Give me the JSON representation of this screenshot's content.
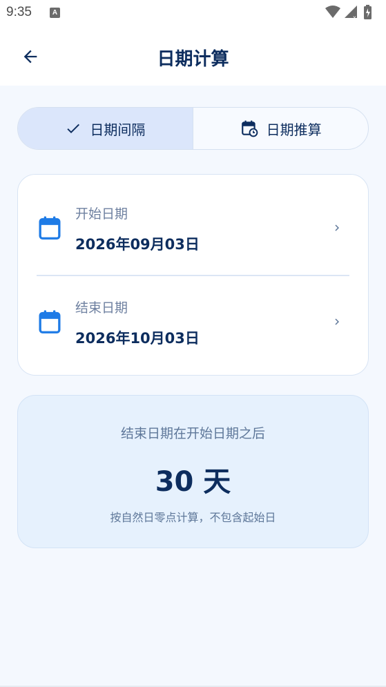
{
  "status_bar": {
    "time": "9:35",
    "notification_glyph": "A"
  },
  "app_bar": {
    "title": "日期计算",
    "back_icon": "arrow-left-icon"
  },
  "segmented": {
    "tabs": [
      {
        "label": "日期间隔",
        "icon": "check-icon",
        "selected": true
      },
      {
        "label": "日期推算",
        "icon": "calendar-clock-icon",
        "selected": false
      }
    ]
  },
  "dates": {
    "start": {
      "label": "开始日期",
      "value": "2026年09月03日"
    },
    "end": {
      "label": "结束日期",
      "value": "2026年10月03日"
    }
  },
  "result": {
    "description": "结束日期在开始日期之后",
    "value": "30 天",
    "note": "按自然日零点计算，不包含起始日"
  },
  "colors": {
    "primary": "#0d2d5e",
    "accent": "#1e7be6",
    "background": "#f4f8fe",
    "result_bg": "#e6f1fd"
  }
}
